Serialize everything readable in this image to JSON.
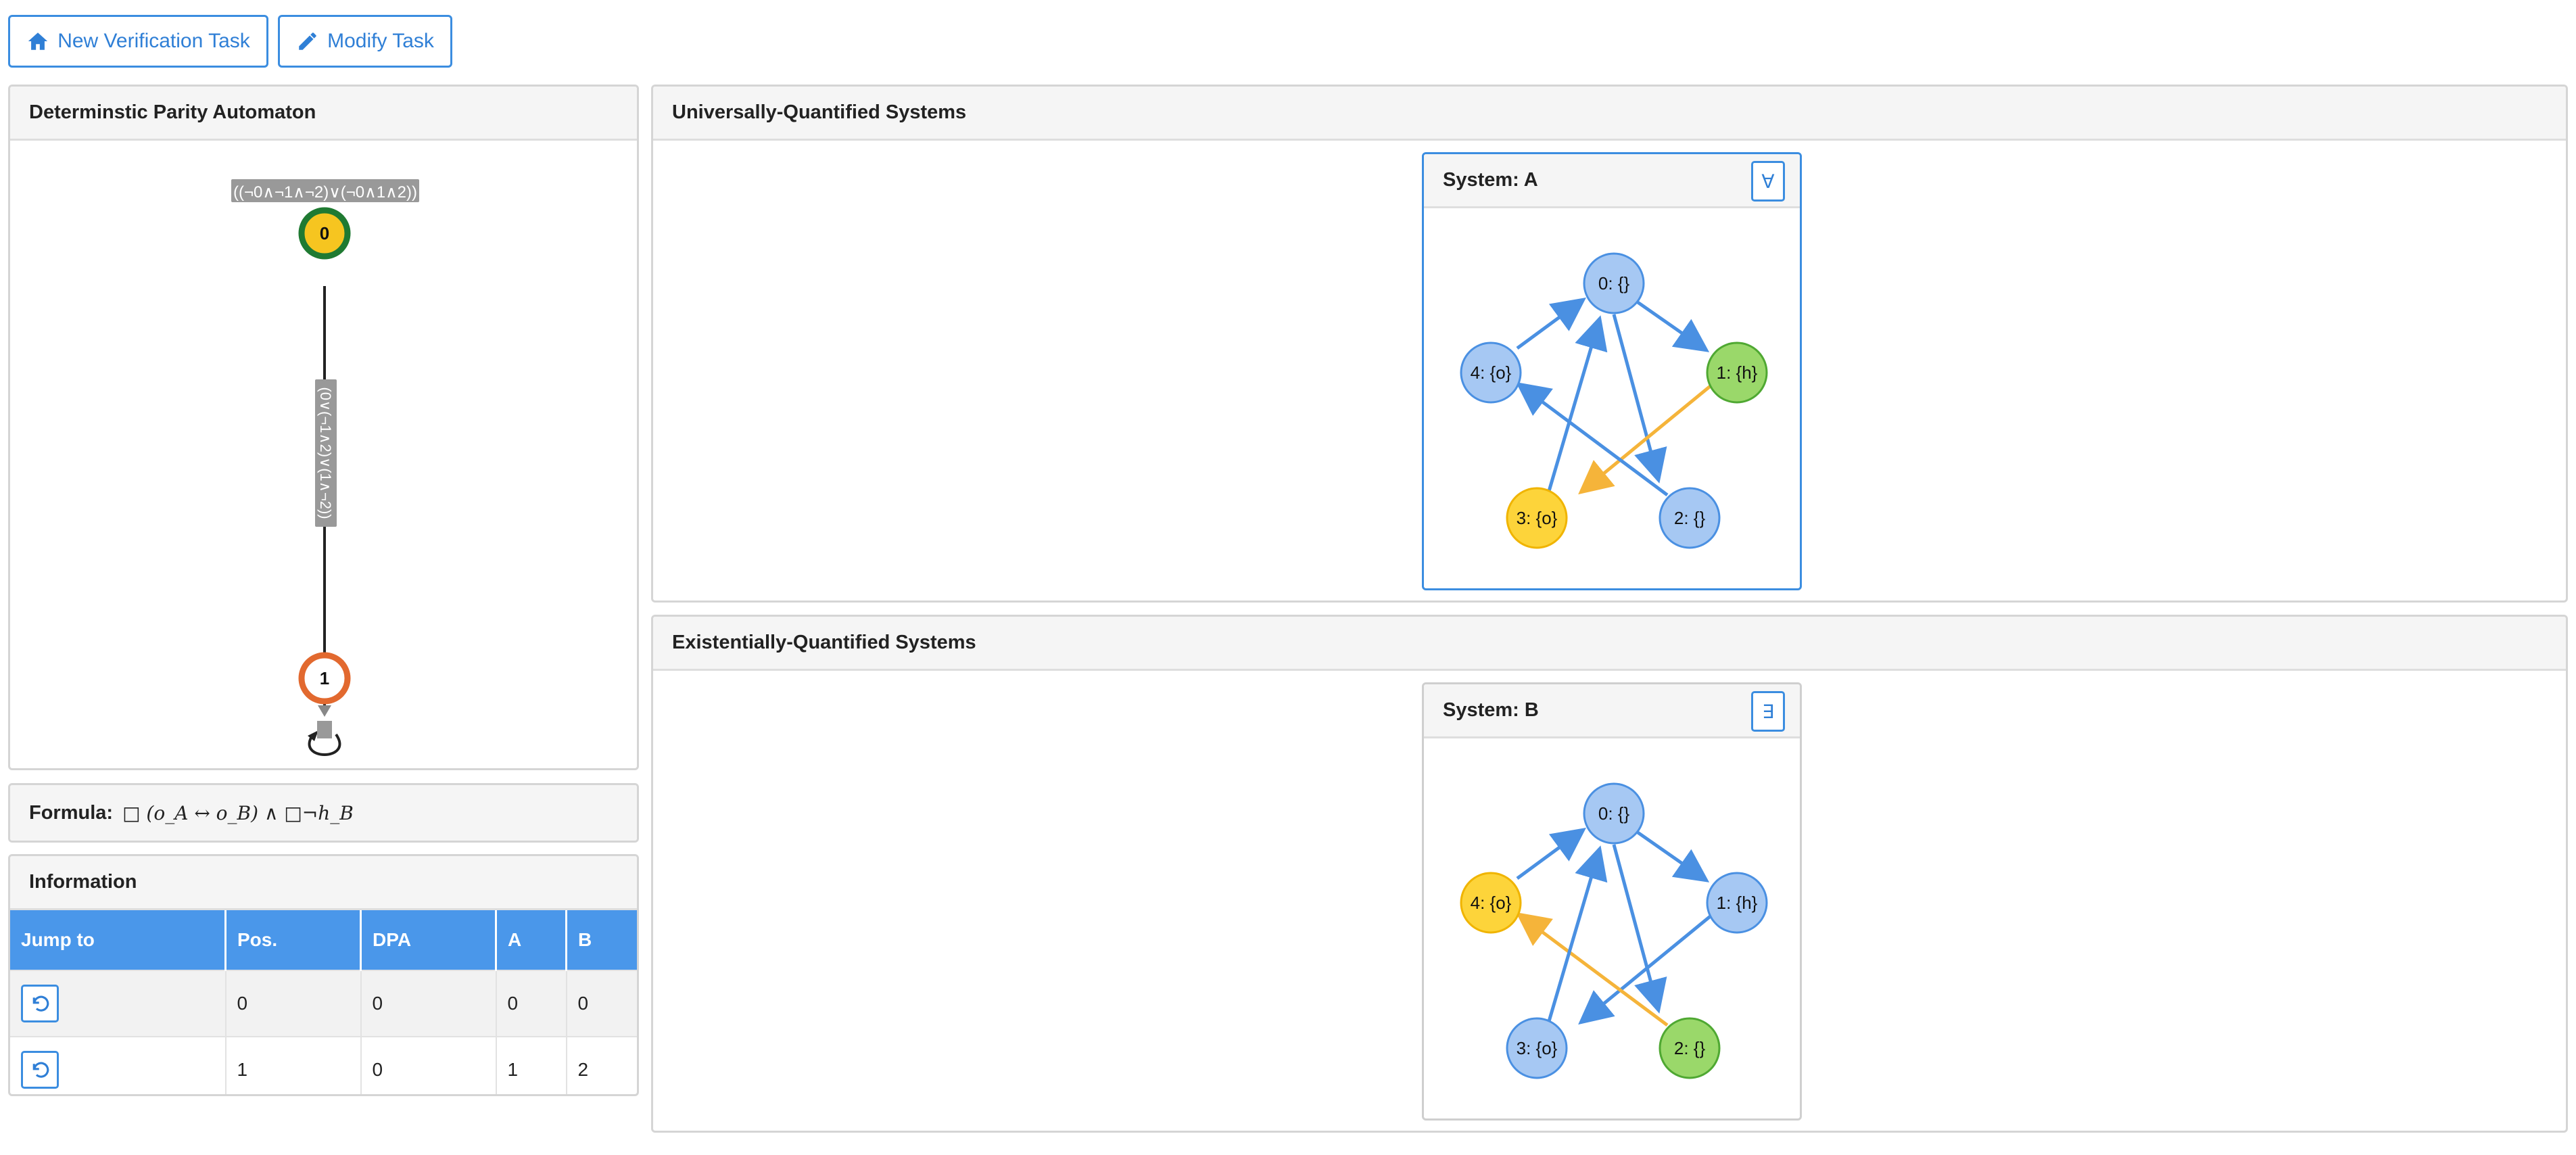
{
  "toolbar": {
    "new_task_label": "New Verification Task",
    "modify_task_label": "Modify Task"
  },
  "dpa": {
    "title": "Determinstic Parity Automaton",
    "state0_label": "0",
    "state1_label": "1",
    "loop0_label": "((¬0∧¬1∧¬2)∨(¬0∧1∧2))",
    "edge_label": "(0∨(¬1∧2)∨(1∧¬2))",
    "state0_color": "#f6c520",
    "state0_ring": "#1f7a32",
    "state1_color": "#ffffff",
    "state1_ring": "#e2692f"
  },
  "formula": {
    "label": "Formula:",
    "text": "□ (o_A ↔ o_B) ∧ □¬h_B"
  },
  "information": {
    "title": "Information",
    "columns": [
      "Jump to",
      "Pos.",
      "DPA",
      "A",
      "B"
    ],
    "rows": [
      {
        "pos": "0",
        "dpa": "0",
        "a": "0",
        "b": "0"
      },
      {
        "pos": "1",
        "dpa": "0",
        "a": "1",
        "b": "2"
      }
    ]
  },
  "universal": {
    "title": "Universally-Quantified Systems",
    "system": {
      "title": "System: A",
      "quantifier": "∀",
      "nodes": [
        "0: {}",
        "1: {h}",
        "2: {}",
        "3: {o}",
        "4: {o}"
      ]
    }
  },
  "existential": {
    "title": "Existentially-Quantified Systems",
    "system": {
      "title": "System: B",
      "quantifier": "∃",
      "nodes": [
        "0: {}",
        "1: {h}",
        "2: {}",
        "3: {o}",
        "4: {o}"
      ]
    }
  },
  "colors": {
    "accent": "#3b8de0",
    "node_blue": "#a6c8f3",
    "node_blue_stroke": "#4a90e2",
    "node_yellow": "#fdd43a",
    "node_yellow_stroke": "#f0b400",
    "node_green": "#9ad86a",
    "node_green_stroke": "#4fa832",
    "edge_blue": "#4a90e2",
    "edge_orange": "#f5b43a"
  }
}
